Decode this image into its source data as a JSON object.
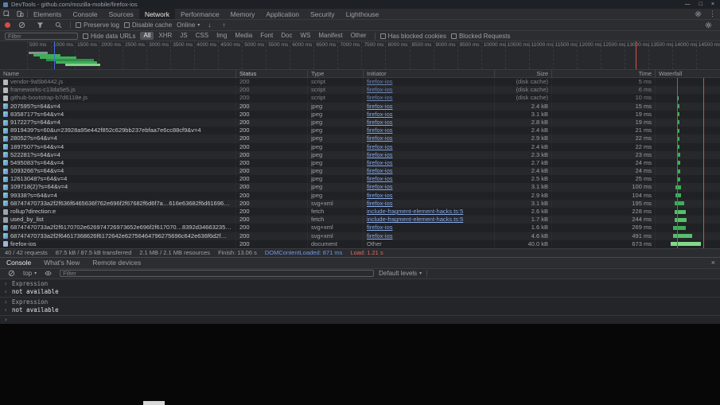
{
  "window": {
    "title": "DevTools - github.com/mozilla-mobile/firefox-ios"
  },
  "icons": {
    "minimize": "—",
    "maximize": "□",
    "close": "×",
    "kebab": "⋮",
    "caret": "▾",
    "arrow_down": "↓",
    "arrow_up": "↑",
    "prompt": "›",
    "input_mark": "›",
    "output_mark": "‹"
  },
  "colors": {
    "accent_blue": "#87a9e8",
    "record_red": "#e04a46",
    "bar_green": "#3fae58",
    "dcl_blue": "#3f6fd1",
    "load_red": "#d4504a"
  },
  "main_tabs": {
    "items": [
      "Elements",
      "Console",
      "Sources",
      "Network",
      "Performance",
      "Memory",
      "Application",
      "Security",
      "Lighthouse"
    ],
    "active": "Network"
  },
  "network_toolbar": {
    "preserve_log": "Preserve log",
    "disable_cache": "Disable cache",
    "throttling": "Online"
  },
  "filter_bar": {
    "placeholder": "Filter",
    "hide_data_urls": "Hide data URLs",
    "types": [
      "All",
      "XHR",
      "JS",
      "CSS",
      "Img",
      "Media",
      "Font",
      "Doc",
      "WS",
      "Manifest",
      "Other"
    ],
    "active_type": "All",
    "has_blocked_cookies": "Has blocked cookies",
    "blocked_requests": "Blocked Requests"
  },
  "overview": {
    "tick_labels": [
      "500 ms",
      "1000 ms",
      "1500 ms",
      "2000 ms",
      "2500 ms",
      "3000 ms",
      "3500 ms",
      "4000 ms",
      "4500 ms",
      "5000 ms",
      "5500 ms",
      "6000 ms",
      "6500 ms",
      "7000 ms",
      "7500 ms",
      "8000 ms",
      "8500 ms",
      "9000 ms",
      "9500 ms",
      "10000 ms",
      "10500 ms",
      "11000 ms",
      "11500 ms",
      "12000 ms",
      "12500 ms",
      "13000 ms",
      "13500 ms",
      "14000 ms",
      "14500 ms"
    ],
    "bars": [
      {
        "l": 36,
        "t": 13,
        "w": 24,
        "h": 2.5,
        "c": "#8a8f94"
      },
      {
        "l": 42,
        "t": 16,
        "w": 34,
        "h": 2.5,
        "c": "#3fae58"
      },
      {
        "l": 50,
        "t": 19,
        "w": 46,
        "h": 2.5,
        "c": "#3fae58"
      },
      {
        "l": 58,
        "t": 22,
        "w": 60,
        "h": 2.5,
        "c": "#2f8f4a"
      },
      {
        "l": 70,
        "t": 25,
        "w": 52,
        "h": 2.5,
        "c": "#3fae58"
      },
      {
        "l": 82,
        "t": 28,
        "w": 44,
        "h": 2.5,
        "c": "#7fd487"
      }
    ],
    "dcl_line_pct": 7.5,
    "load_line_pct": 88.3
  },
  "table": {
    "columns": [
      {
        "key": "name",
        "label": "Name"
      },
      {
        "key": "status",
        "label": "Status"
      },
      {
        "key": "type",
        "label": "Type"
      },
      {
        "key": "initiator",
        "label": "Initiator"
      },
      {
        "key": "size",
        "label": "Size"
      },
      {
        "key": "time",
        "label": "Time"
      },
      {
        "key": "waterfall",
        "label": "Waterfall"
      }
    ],
    "waterfall": {
      "dcl_pct": 34.5,
      "load_pct": 74
    },
    "rows": [
      {
        "name": "vendor-9a5b6442.js",
        "icon": "script",
        "status": "200",
        "type": "script",
        "initiator": "firefox-ios",
        "link": true,
        "size": "(disk cache)",
        "time": "5 ms",
        "dim": true,
        "wf": {
          "s": 33,
          "w": 2,
          "c": "#6fae8f"
        }
      },
      {
        "name": "frameworks-c13da5e5.js",
        "icon": "script",
        "status": "200",
        "type": "script",
        "initiator": "firefox-ios",
        "link": true,
        "size": "(disk cache)",
        "time": "6 ms",
        "dim": true,
        "wf": {
          "s": 33,
          "w": 2,
          "c": "#6fae8f"
        }
      },
      {
        "name": "github-bootstrap-b7d6118e.js",
        "icon": "script",
        "status": "200",
        "type": "script",
        "initiator": "firefox-ios",
        "link": true,
        "size": "(disk cache)",
        "time": "10 ms",
        "dim": true,
        "wf": {
          "s": 33,
          "w": 2.5,
          "c": "#6fae8f"
        }
      },
      {
        "name": "207595?s=64&v=4",
        "icon": "image",
        "status": "200",
        "type": "jpeg",
        "initiator": "firefox-ios",
        "link": true,
        "size": "2.4 kB",
        "time": "15 ms",
        "dim": false,
        "wf": {
          "s": 33.5,
          "w": 3,
          "c": "#3fae58"
        }
      },
      {
        "name": "8358717?s=64&v=4",
        "icon": "image",
        "status": "200",
        "type": "jpeg",
        "initiator": "firefox-ios",
        "link": true,
        "size": "3.1 kB",
        "time": "19 ms",
        "dim": false,
        "wf": {
          "s": 33.5,
          "w": 3,
          "c": "#3fae58"
        }
      },
      {
        "name": "917227?s=64&v=4",
        "icon": "image",
        "status": "200",
        "type": "jpeg",
        "initiator": "firefox-ios",
        "link": true,
        "size": "2.8 kB",
        "time": "19 ms",
        "dim": false,
        "wf": {
          "s": 33.5,
          "w": 3,
          "c": "#3fae58"
        }
      },
      {
        "name": "8919439?s=60&u=23928a95e442f852c629bb237ebfaa7e6cc88cf9&v=4",
        "icon": "image",
        "status": "200",
        "type": "jpeg",
        "initiator": "firefox-ios",
        "link": true,
        "size": "2.4 kB",
        "time": "21 ms",
        "dim": false,
        "wf": {
          "s": 34,
          "w": 3.5,
          "c": "#3fae58"
        }
      },
      {
        "name": "28052?s=64&v=4",
        "icon": "image",
        "status": "200",
        "type": "jpeg",
        "initiator": "firefox-ios",
        "link": true,
        "size": "2.9 kB",
        "time": "22 ms",
        "dim": false,
        "wf": {
          "s": 34,
          "w": 3.5,
          "c": "#3fae58"
        }
      },
      {
        "name": "1897507?s=64&v=4",
        "icon": "image",
        "status": "200",
        "type": "jpeg",
        "initiator": "firefox-ios",
        "link": true,
        "size": "2.4 kB",
        "time": "22 ms",
        "dim": false,
        "wf": {
          "s": 34,
          "w": 3.5,
          "c": "#3fae58"
        }
      },
      {
        "name": "522281?s=64&v=4",
        "icon": "image",
        "status": "200",
        "type": "jpeg",
        "initiator": "firefox-ios",
        "link": true,
        "size": "2.3 kB",
        "time": "23 ms",
        "dim": false,
        "wf": {
          "s": 34,
          "w": 4,
          "c": "#3fae58"
        }
      },
      {
        "name": "5495083?s=64&v=4",
        "icon": "image",
        "status": "200",
        "type": "jpeg",
        "initiator": "firefox-ios",
        "link": true,
        "size": "2.7 kB",
        "time": "24 ms",
        "dim": false,
        "wf": {
          "s": 34,
          "w": 4,
          "c": "#3fae58"
        }
      },
      {
        "name": "1093266?s=64&v=4",
        "icon": "image",
        "status": "200",
        "type": "jpeg",
        "initiator": "firefox-ios",
        "link": true,
        "size": "2.4 kB",
        "time": "24 ms",
        "dim": false,
        "wf": {
          "s": 34,
          "w": 4,
          "c": "#3fae58"
        }
      },
      {
        "name": "12613048?s=64&v=4",
        "icon": "image",
        "status": "200",
        "type": "jpeg",
        "initiator": "firefox-ios",
        "link": true,
        "size": "2.5 kB",
        "time": "25 ms",
        "dim": false,
        "wf": {
          "s": 34,
          "w": 4,
          "c": "#3fae58"
        }
      },
      {
        "name": "109718(2)?s=64&v=4",
        "icon": "image",
        "status": "200",
        "type": "jpeg",
        "initiator": "firefox-ios",
        "link": true,
        "size": "3.1 kB",
        "time": "100 ms",
        "dim": false,
        "wf": {
          "s": 31,
          "w": 8,
          "c": "#3fae58"
        }
      },
      {
        "name": "99338?s=64&v=4",
        "icon": "image",
        "status": "200",
        "type": "jpeg",
        "initiator": "firefox-ios",
        "link": true,
        "size": "2.9 kB",
        "time": "104 ms",
        "dim": false,
        "wf": {
          "s": 31,
          "w": 9,
          "c": "#3fae58"
        }
      },
      {
        "name": "68747470733a2f2f636f6465636f762e696f2f67682f6d6f7a…616e63682f6d61696e2f67726170682f62616467652e737667…",
        "icon": "image",
        "status": "200",
        "type": "svg+xml",
        "initiator": "firefox-ios",
        "link": true,
        "size": "3.1 kB",
        "time": "195 ms",
        "dim": false,
        "wf": {
          "s": 30,
          "w": 14,
          "c": "#3fae58"
        }
      },
      {
        "name": "rollup?direction:e",
        "icon": "fetch",
        "status": "200",
        "type": "fetch",
        "initiator": "include-fragment-element-hacks.ts:5",
        "link": true,
        "size": "2.6 kB",
        "time": "228 ms",
        "dim": false,
        "wf": {
          "s": 30,
          "w": 17,
          "c": "#56c16c"
        }
      },
      {
        "name": "used_by_list",
        "icon": "fetch",
        "status": "200",
        "type": "fetch",
        "initiator": "include-fragment-element-hacks.ts:5",
        "link": true,
        "size": "1.7 kB",
        "time": "244 ms",
        "dim": false,
        "wf": {
          "s": 30,
          "w": 18,
          "c": "#56c16c"
        }
      },
      {
        "name": "68747470733a2f2f6170702e626974726973652e696f2f617070…8392d346632352d62613866d17363638613963313335…",
        "icon": "image",
        "status": "200",
        "type": "svg+xml",
        "initiator": "firefox-ios",
        "link": true,
        "size": "1.6 kB",
        "time": "269 ms",
        "dim": false,
        "wf": {
          "s": 27,
          "w": 20,
          "c": "#3fae58"
        }
      },
      {
        "name": "68747470733a2f2f64617368626f6172642e62756464796275696c642e636f6d2f…6272616e63683d6d61696e266275696c643d6c61…",
        "icon": "image",
        "status": "200",
        "type": "svg+xml",
        "initiator": "firefox-ios",
        "link": true,
        "size": "4.6 kB",
        "time": "491 ms",
        "dim": false,
        "wf": {
          "s": 27,
          "w": 30,
          "c": "#56c16c"
        }
      },
      {
        "name": "firefox-ios",
        "icon": "doc",
        "status": "200",
        "type": "document",
        "initiator": "Other",
        "link": false,
        "size": "40.0 kB",
        "time": "673 ms",
        "dim": false,
        "wf": {
          "s": 23,
          "w": 47,
          "c": "#83d98b"
        }
      }
    ]
  },
  "summary": {
    "requests": "40 / 42 requests",
    "transferred": "87.5 kB / 87.5 kB transferred",
    "resources": "2.1 MB / 2.1 MB resources",
    "finish": "Finish: 13.06 s",
    "dcl": "DOMContentLoaded: 871 ms",
    "load": "Load: 1.21 s"
  },
  "drawer": {
    "tabs": [
      "Console",
      "What's New",
      "Remote devices"
    ],
    "active_tab": "Console",
    "context_selector": "top",
    "filter_placeholder": "Filter",
    "levels_selector": "Default levels",
    "messages": [
      {
        "input": "Expression",
        "output": "not available"
      },
      {
        "input": "Expression",
        "output": "not available"
      }
    ]
  }
}
